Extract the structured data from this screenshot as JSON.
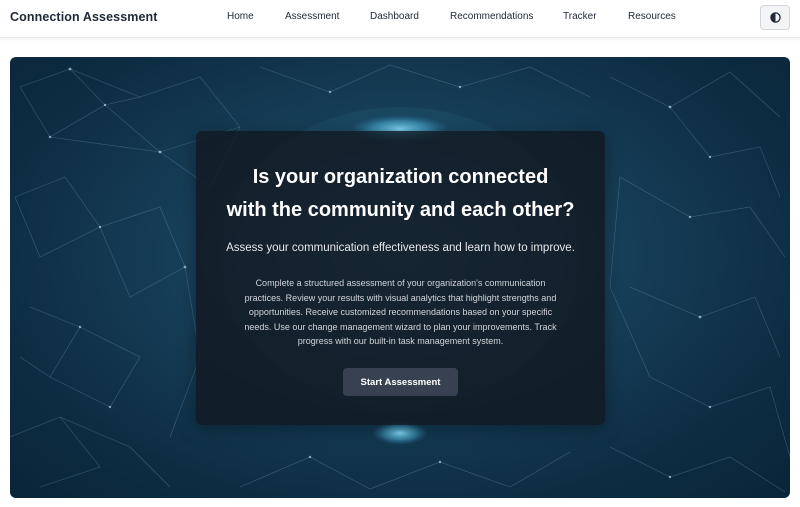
{
  "app": {
    "brand": "Connection Assessment"
  },
  "nav": {
    "links": [
      {
        "label": "Home"
      },
      {
        "label": "Assessment"
      },
      {
        "label": "Dashboard"
      },
      {
        "label": "Recommendations"
      },
      {
        "label": "Tracker"
      },
      {
        "label": "Resources"
      }
    ],
    "theme_toggle_icon": "contrast-icon"
  },
  "hero": {
    "headline_line1": "Is your organization connected",
    "headline_line2": "with the community and each other?",
    "subheadline": "Assess your communication effectiveness and learn how to improve.",
    "description": "Complete a structured assessment of your organization's communication practices. Review your results with visual analytics that highlight strengths and opportunities. Receive customized recommendations based on your specific needs. Use our change management wizard to plan your improvements. Track progress with our built-in task management system.",
    "cta_label": "Start Assessment"
  },
  "colors": {
    "hero_bg": "#17405a",
    "card_bg": "#111821",
    "cta_bg": "#374151",
    "glow": "#6fd0f0"
  }
}
